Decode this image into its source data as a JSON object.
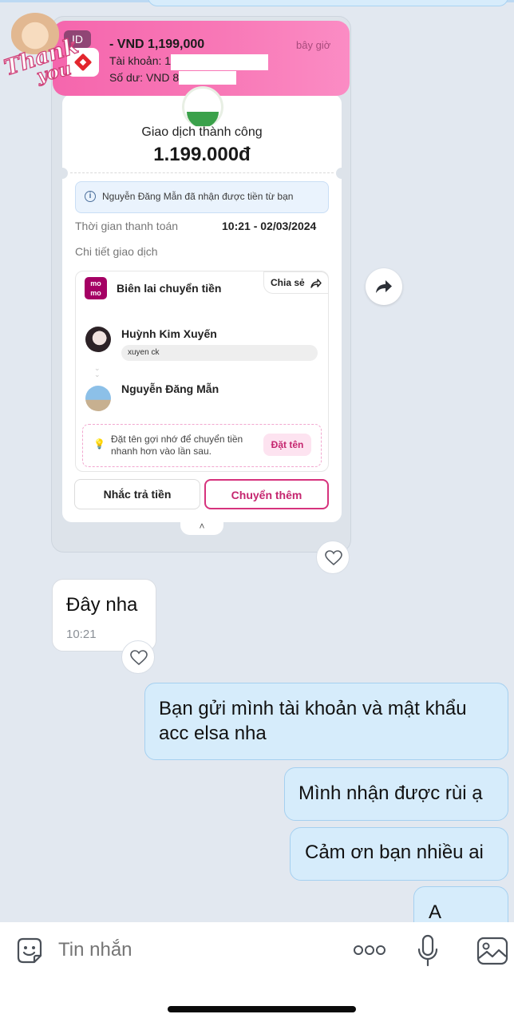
{
  "notification": {
    "tag": "ID",
    "amount": "- VND 1,199,000",
    "time": "bây giờ",
    "account_label": "Tài khoản: ",
    "account_partial": "1",
    "balance_label": "Số dư: VND ",
    "balance_partial": "8"
  },
  "transaction": {
    "status": "Giao dịch thành công",
    "amount": "1.199.000đ",
    "info_message": "Nguyễn Đăng Mẫn đã nhận được tiền từ bạn",
    "payment_time_label": "Thời gian thanh toán",
    "payment_time_value": "10:21 - 02/03/2024",
    "details_label": "Chi tiết giao dịch",
    "receipt_title": "Biên lai chuyển tiền",
    "momo_logo": "mo mo",
    "share_label": "Chia sẻ",
    "sender_name": "Huỳnh Kim Xuyến",
    "memo": "xuyen ck",
    "receiver_name": "Nguyễn Đăng Mẫn",
    "tip_text": "Đặt tên gợi nhớ để chuyển tiền nhanh hơn vào lần sau.",
    "tip_button": "Đặt tên",
    "remind_button": "Nhắc trả tiền",
    "transfer_more_button": "Chuyển thêm",
    "collapse_glyph": "˄"
  },
  "sticker": {
    "line1": "Thank",
    "line2": "you"
  },
  "messages": {
    "incoming": {
      "text": "Đây nha",
      "time": "10:21"
    },
    "outgoing": [
      {
        "text": "Bạn gửi mình tài khoản và mật khẩu acc elsa nha"
      },
      {
        "text": "Mình nhận được rùi ạ"
      },
      {
        "text": "Cảm ơn bạn nhiều ai"
      },
      {
        "text": "A"
      }
    ]
  },
  "composer": {
    "placeholder": "Tin nhắn"
  },
  "icons": {
    "sticker": "sticker-icon",
    "more": "more-icon",
    "microphone": "microphone-icon",
    "image": "image-icon",
    "forward": "forward-icon",
    "heart": "heart-icon",
    "check": "check-icon",
    "info": "info-icon",
    "lightbulb": "lightbulb-icon",
    "share": "share-icon"
  },
  "colors": {
    "chat_background": "#e2e8f0",
    "outgoing_bubble": "#d6ecfb",
    "momo_pink": "#a50064",
    "accent_pink": "#c5266f",
    "notification_pink": "#f566ad",
    "success_green": "#3aa14a"
  }
}
